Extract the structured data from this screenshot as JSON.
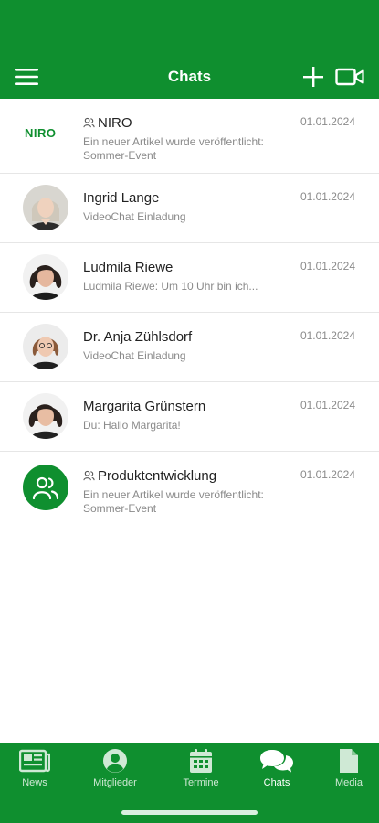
{
  "appbar": {
    "title": "Chats"
  },
  "chats": [
    {
      "name": "NIRO",
      "group": true,
      "logo_text": "NIRO",
      "preview": "Ein neuer Artikel wurde veröffentlicht: Sommer-Event",
      "date": "01.01.2024"
    },
    {
      "name": "Ingrid Lange",
      "group": false,
      "preview": "VideoChat Einladung",
      "date": "01.01.2024"
    },
    {
      "name": "Ludmila Riewe",
      "group": false,
      "preview": "Ludmila Riewe: Um 10 Uhr bin ich...",
      "date": "01.01.2024"
    },
    {
      "name": "Dr. Anja Zühlsdorf",
      "group": false,
      "preview": "VideoChat Einladung",
      "date": "01.01.2024"
    },
    {
      "name": "Margarita Grünstern",
      "group": false,
      "preview": "Du: Hallo Margarita!",
      "date": "01.01.2024"
    },
    {
      "name": "Produktentwicklung",
      "group": true,
      "preview": "Ein neuer Artikel wurde veröffentlicht: Sommer-Event",
      "date": "01.01.2024"
    }
  ],
  "nav": [
    {
      "label": "News",
      "icon": "newspaper-icon"
    },
    {
      "label": "Mitglieder",
      "icon": "person-circle-icon"
    },
    {
      "label": "Termine",
      "icon": "calendar-icon"
    },
    {
      "label": "Chats",
      "icon": "chat-bubbles-icon",
      "active": true
    },
    {
      "label": "Media",
      "icon": "document-icon"
    }
  ],
  "colors": {
    "brand": "#0f8f2f",
    "text": "#222222",
    "muted": "#8a8a8a"
  }
}
